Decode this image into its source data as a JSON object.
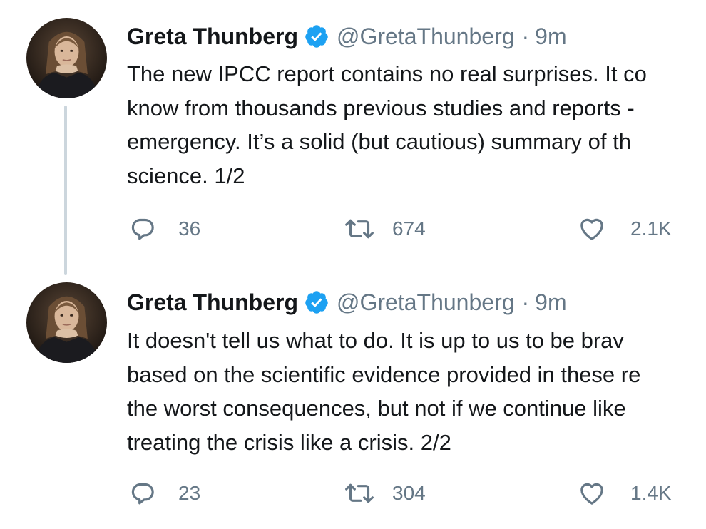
{
  "colors": {
    "text": "#14171a",
    "secondary": "#657786",
    "verified": "#1da1f2",
    "thread_line": "#ccd6dd"
  },
  "tweets": [
    {
      "author": {
        "name": "Greta Thunberg",
        "handle": "@GretaThunberg",
        "verified_icon": "verified-badge-icon",
        "avatar_icon": "profile-photo"
      },
      "separator": "·",
      "time": "9m",
      "lines": [
        "The new IPCC report contains no real surprises. It co",
        "know from thousands previous studies and reports -",
        "emergency. It’s a solid (but cautious) summary of th",
        "science. 1/2"
      ],
      "stats": {
        "replies": "36",
        "retweets": "674",
        "likes": "2.1K"
      }
    },
    {
      "author": {
        "name": "Greta Thunberg",
        "handle": "@GretaThunberg",
        "verified_icon": "verified-badge-icon",
        "avatar_icon": "profile-photo"
      },
      "separator": "·",
      "time": "9m",
      "lines": [
        "It doesn't tell us what to do. It is up to us to be brav",
        "based on the scientific evidence provided in these re",
        "the worst consequences, but not if we continue like",
        "treating the crisis like a crisis. 2/2"
      ],
      "stats": {
        "replies": "23",
        "retweets": "304",
        "likes": "1.4K"
      }
    }
  ],
  "icons": {
    "reply": "reply-icon",
    "retweet": "retweet-icon",
    "like": "heart-icon"
  }
}
